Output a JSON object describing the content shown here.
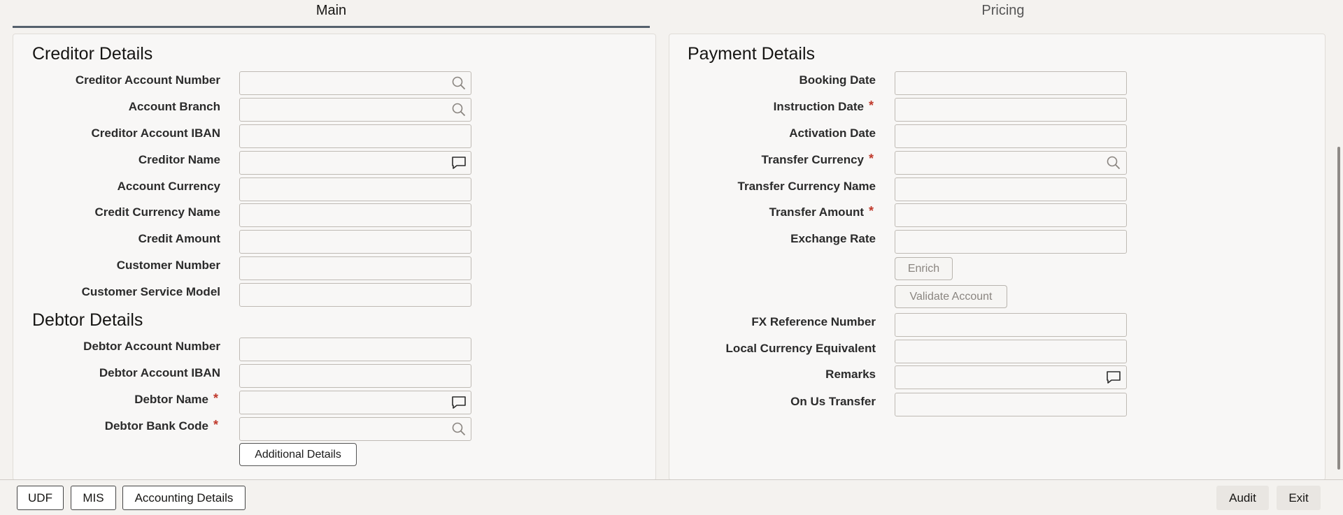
{
  "tabs": {
    "main": "Main",
    "pricing": "Pricing"
  },
  "creditor": {
    "title": "Creditor Details",
    "fields": {
      "account_number": {
        "label": "Creditor Account Number",
        "value": ""
      },
      "account_branch": {
        "label": "Account Branch",
        "value": ""
      },
      "account_iban": {
        "label": "Creditor Account IBAN",
        "value": ""
      },
      "name": {
        "label": "Creditor Name",
        "value": ""
      },
      "account_currency": {
        "label": "Account Currency",
        "value": ""
      },
      "credit_currency_name": {
        "label": "Credit Currency Name",
        "value": ""
      },
      "credit_amount": {
        "label": "Credit Amount",
        "value": ""
      },
      "customer_number": {
        "label": "Customer Number",
        "value": ""
      },
      "customer_service_model": {
        "label": "Customer Service Model",
        "value": ""
      }
    }
  },
  "debtor": {
    "title": "Debtor Details",
    "fields": {
      "account_number": {
        "label": "Debtor Account Number",
        "value": ""
      },
      "account_iban": {
        "label": "Debtor Account IBAN",
        "value": ""
      },
      "name": {
        "label": "Debtor Name",
        "value": ""
      },
      "bank_code": {
        "label": "Debtor Bank Code",
        "value": ""
      }
    },
    "additional_details_button": "Additional Details"
  },
  "payment": {
    "title": "Payment Details",
    "fields": {
      "booking_date": {
        "label": "Booking Date",
        "value": ""
      },
      "instruction_date": {
        "label": "Instruction Date",
        "value": ""
      },
      "activation_date": {
        "label": "Activation Date",
        "value": ""
      },
      "transfer_currency": {
        "label": "Transfer Currency",
        "value": ""
      },
      "transfer_currency_name": {
        "label": "Transfer Currency Name",
        "value": ""
      },
      "transfer_amount": {
        "label": "Transfer Amount",
        "value": ""
      },
      "exchange_rate": {
        "label": "Exchange Rate",
        "value": ""
      },
      "fx_reference_number": {
        "label": "FX Reference Number",
        "value": ""
      },
      "local_currency_equivalent": {
        "label": "Local Currency Equivalent",
        "value": ""
      },
      "remarks": {
        "label": "Remarks",
        "value": ""
      },
      "on_us_transfer": {
        "label": "On Us Transfer",
        "value": ""
      }
    },
    "enrich_button": "Enrich",
    "validate_account_button": "Validate Account"
  },
  "required_marker": "*",
  "footer": {
    "udf": "UDF",
    "mis": "MIS",
    "accounting_details": "Accounting Details",
    "audit": "Audit",
    "exit": "Exit"
  },
  "icons": {
    "lookup": "search-icon",
    "note": "speech-bubble-icon"
  }
}
